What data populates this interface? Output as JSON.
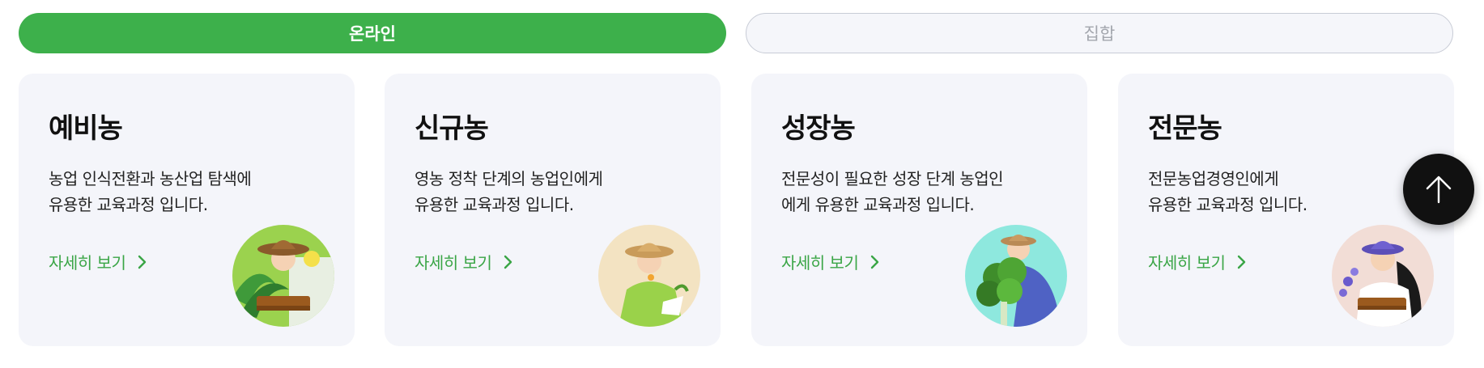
{
  "tabs": {
    "online": "온라인",
    "group": "집합"
  },
  "cards": [
    {
      "title": "예비농",
      "desc_line1": "농업 인식전환과 농산업 탐색에",
      "desc_line2": "유용한 교육과정 입니다.",
      "link": "자세히 보기",
      "image_bg": "#9bd24e"
    },
    {
      "title": "신규농",
      "desc_line1": "영농 정착 단계의 농업인에게",
      "desc_line2": "유용한 교육과정 입니다.",
      "link": "자세히 보기",
      "image_bg": "#f3e3c2"
    },
    {
      "title": "성장농",
      "desc_line1": "전문성이 필요한 성장 단계 농업인",
      "desc_line2": "에게 유용한 교육과정 입니다.",
      "link": "자세히 보기",
      "image_bg": "#8ee8de"
    },
    {
      "title": "전문농",
      "desc_line1": "전문농업경영인에게",
      "desc_line2": "유용한 교육과정 입니다.",
      "link": "자세히 보기",
      "image_bg": "#f2ddd6"
    }
  ],
  "colors": {
    "accent": "#3db04b",
    "link": "#3aa546",
    "card_bg": "#f4f5fa"
  }
}
